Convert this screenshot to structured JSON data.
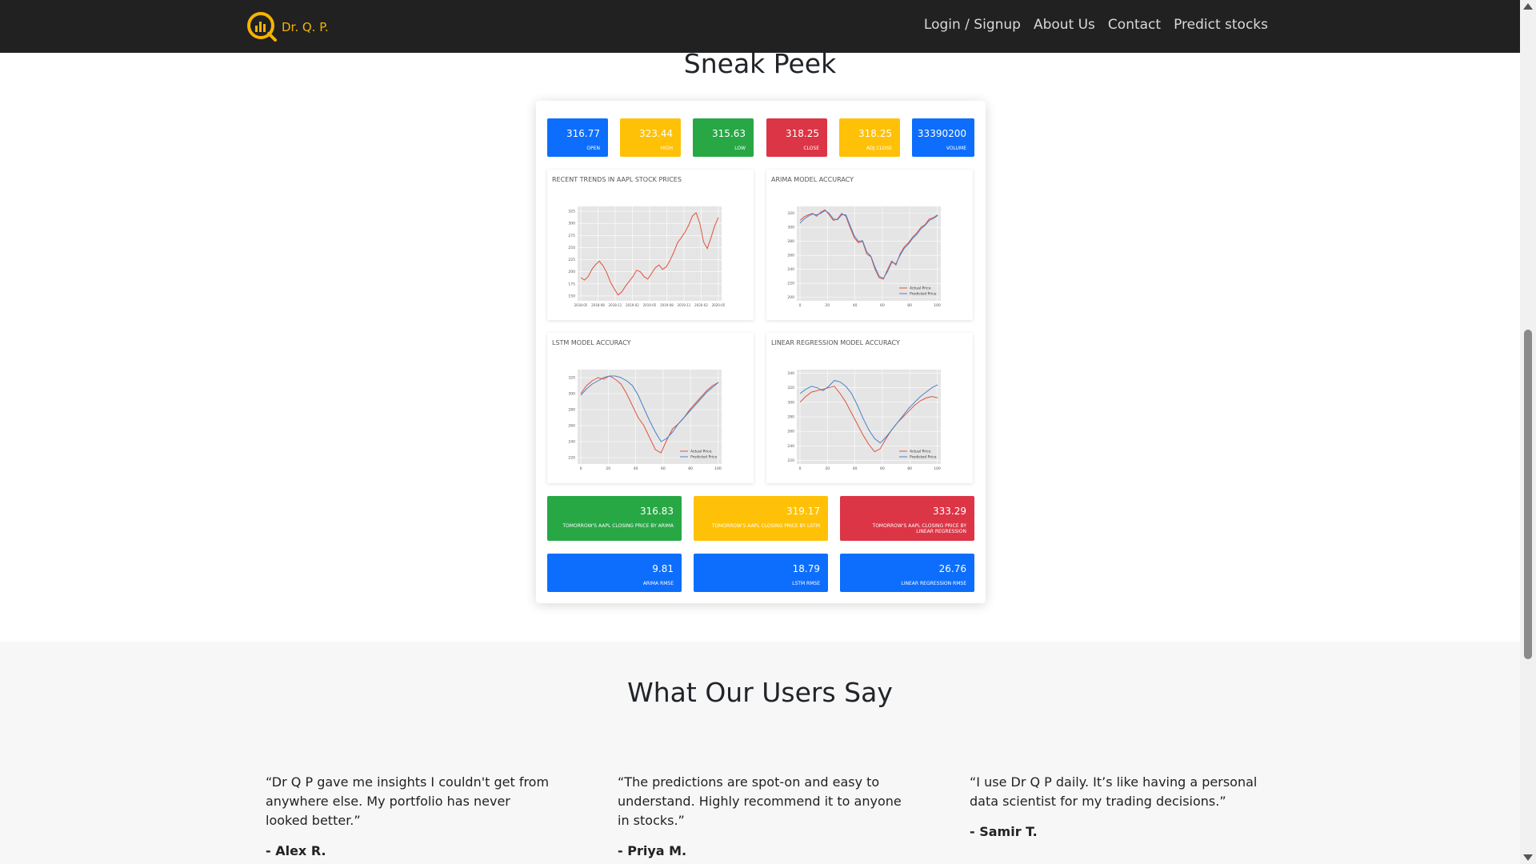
{
  "nav": {
    "brand": "Dr. Q. P.",
    "links": [
      "Login / Signup",
      "About Us",
      "Contact",
      "Predict stocks"
    ],
    "colors": {
      "bg": "#212121",
      "brand": "#f5b301"
    }
  },
  "sneak_peek": {
    "title": "Sneak Peek",
    "stats": [
      {
        "value": "316.77",
        "label": "OPEN",
        "color": "blue"
      },
      {
        "value": "323.44",
        "label": "HIGH",
        "color": "yellow"
      },
      {
        "value": "315.63",
        "label": "LOW",
        "color": "green"
      },
      {
        "value": "318.25",
        "label": "CLOSE",
        "color": "red"
      },
      {
        "value": "318.25",
        "label": "ADJ CLOSE",
        "color": "yellow"
      },
      {
        "value": "33390200",
        "label": "VOLUME",
        "color": "blue"
      }
    ],
    "charts": [
      {
        "title": "RECENT TRENDS IN AAPL STOCK PRICES"
      },
      {
        "title": "ARIMA MODEL ACCURACY"
      },
      {
        "title": "LSTM MODEL ACCURACY"
      },
      {
        "title": "LINEAR REGRESSION MODEL ACCURACY"
      }
    ],
    "predictions": [
      {
        "value": "316.83",
        "label": "TOMORROW'S AAPL CLOSING PRICE BY ARIMA",
        "color": "green"
      },
      {
        "value": "319.17",
        "label": "TOMORROW'S AAPL CLOSING PRICE BY LSTM",
        "color": "yellow"
      },
      {
        "value": "333.29",
        "label": "TOMORROW'S AAPL CLOSING PRICE BY LINEAR REGRESSION",
        "color": "red"
      }
    ],
    "rmse": [
      {
        "value": "9.81",
        "label": "ARIMA RMSE"
      },
      {
        "value": "18.79",
        "label": "LSTM RMSE"
      },
      {
        "value": "26.76",
        "label": "LINEAR REGRESSION RMSE"
      }
    ]
  },
  "chart_data": [
    {
      "type": "line",
      "title": "RECENT TRENDS IN AAPL STOCK PRICES",
      "x": [
        "2018-05",
        "2018-08",
        "2018-11",
        "2019-02",
        "2019-05",
        "2019-08",
        "2019-11",
        "2020-02",
        "2020-05"
      ],
      "y_ticks": [
        150,
        175,
        200,
        225,
        250,
        275,
        300,
        325
      ],
      "ylim": [
        140,
        335
      ],
      "series": [
        {
          "values": [
            188,
            183,
            190,
            205,
            215,
            222,
            212,
            198,
            178,
            165,
            152,
            158,
            170,
            180,
            190,
            203,
            200,
            190,
            185,
            196,
            208,
            214,
            205,
            210,
            224,
            240,
            260,
            270,
            282,
            296,
            315,
            322,
            300,
            262,
            248,
            270,
            295,
            312
          ]
        }
      ],
      "grid": true
    },
    {
      "type": "line",
      "title": "ARIMA MODEL ACCURACY",
      "x_ticks": [
        0,
        20,
        40,
        60,
        80,
        100
      ],
      "y_ticks": [
        200,
        220,
        240,
        260,
        280,
        300,
        320
      ],
      "xlim": [
        0,
        105
      ],
      "ylim": [
        195,
        330
      ],
      "series": [
        {
          "name": "Actual Price",
          "values": [
            310,
            315,
            318,
            320,
            316,
            322,
            325,
            318,
            310,
            312,
            320,
            316,
            300,
            285,
            278,
            280,
            262,
            258,
            240,
            228,
            226,
            240,
            252,
            246,
            262,
            272,
            278,
            286,
            292,
            300,
            304,
            312,
            314,
            318
          ]
        },
        {
          "name": "Predicted Price",
          "values": [
            306,
            312,
            316,
            319,
            318,
            320,
            324,
            320,
            312,
            311,
            318,
            318,
            303,
            288,
            280,
            281,
            265,
            259,
            243,
            230,
            227,
            237,
            250,
            248,
            260,
            270,
            276,
            284,
            290,
            298,
            303,
            310,
            313,
            317
          ]
        }
      ],
      "legend": "bottom-right",
      "grid": true
    },
    {
      "type": "line",
      "title": "LSTM MODEL ACCURACY",
      "x_ticks": [
        0,
        20,
        40,
        60,
        80,
        100
      ],
      "y_ticks": [
        220,
        240,
        260,
        280,
        300,
        320
      ],
      "xlim": [
        0,
        105
      ],
      "ylim": [
        212,
        330
      ],
      "series": [
        {
          "name": "Actual Price",
          "values": [
            300,
            310,
            316,
            320,
            318,
            322,
            318,
            312,
            300,
            285,
            270,
            260,
            245,
            230,
            226,
            242,
            256,
            262,
            270,
            280,
            288,
            296,
            304,
            310,
            314
          ]
        },
        {
          "name": "Predicted Price",
          "values": [
            298,
            306,
            312,
            316,
            320,
            322,
            322,
            320,
            316,
            310,
            298,
            282,
            266,
            252,
            240,
            244,
            252,
            262,
            270,
            278,
            286,
            294,
            302,
            308,
            314
          ]
        }
      ],
      "legend": "bottom-right",
      "grid": true
    },
    {
      "type": "line",
      "title": "LINEAR REGRESSION MODEL ACCURACY",
      "x_ticks": [
        0,
        20,
        40,
        60,
        80,
        100
      ],
      "y_ticks": [
        220,
        240,
        260,
        280,
        300,
        320,
        340
      ],
      "xlim": [
        0,
        105
      ],
      "ylim": [
        215,
        345
      ],
      "series": [
        {
          "name": "Actual Price",
          "values": [
            300,
            308,
            314,
            316,
            318,
            320,
            322,
            312,
            300,
            285,
            270,
            255,
            242,
            232,
            236,
            250,
            262,
            272,
            280,
            288,
            296,
            302,
            306,
            308,
            306
          ]
        },
        {
          "name": "Predicted Price",
          "values": [
            312,
            318,
            322,
            320,
            316,
            322,
            330,
            328,
            322,
            312,
            296,
            278,
            262,
            250,
            244,
            252,
            262,
            272,
            282,
            292,
            300,
            308,
            314,
            320,
            324
          ]
        }
      ],
      "legend": "bottom-right",
      "grid": true
    }
  ],
  "testimonials": {
    "title": "What Our Users Say",
    "items": [
      {
        "quote": "“Dr Q P gave me insights I couldn't get from anywhere else. My portfolio has never looked better.”",
        "author": "- Alex R."
      },
      {
        "quote": "“The predictions are spot-on and easy to understand. Highly recommend it to anyone in stocks.”",
        "author": "- Priya M."
      },
      {
        "quote": "“I use Dr Q P daily. It’s like having a personal data scientist for my trading decisions.”",
        "author": "- Samir T."
      }
    ]
  }
}
